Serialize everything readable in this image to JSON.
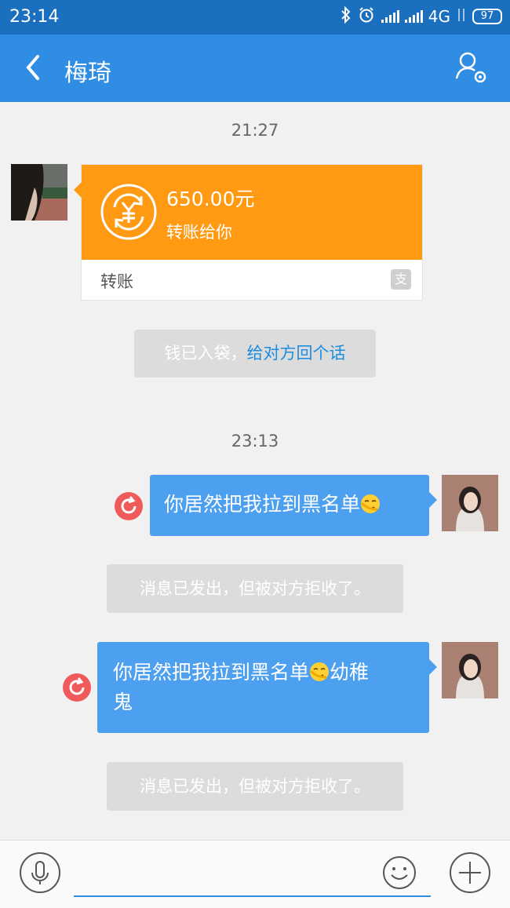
{
  "status": {
    "time": "23:14",
    "network": "4G",
    "battery": "97"
  },
  "header": {
    "title": "梅琦"
  },
  "chat": {
    "ts1": "21:27",
    "transfer": {
      "amount": "650.00元",
      "note": "转账给你",
      "label": "转账"
    },
    "sys_received": {
      "text": "钱已入袋，",
      "link": "给对方回个话"
    },
    "ts2": "23:13",
    "msg1": {
      "text": "你居然把我拉到黑名单"
    },
    "sys_rejected_1": "消息已发出，但被对方拒收了。",
    "msg2": {
      "text_line1": "你居然把我拉到黑名单",
      "text_line1_tail": "幼稚",
      "text_line2": "鬼"
    },
    "sys_rejected_2": "消息已发出，但被对方拒收了。"
  },
  "input": {
    "placeholder": ""
  }
}
